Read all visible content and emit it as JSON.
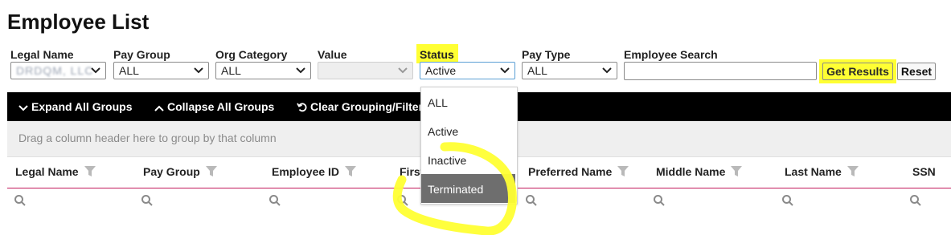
{
  "page": {
    "title": "Employee List"
  },
  "filters": {
    "legal_name": {
      "label": "Legal Name",
      "value": "DRDQM, LLC"
    },
    "pay_group": {
      "label": "Pay Group",
      "value": "ALL"
    },
    "org_category": {
      "label": "Org Category",
      "value": "ALL"
    },
    "value_field": {
      "label": "Value",
      "value": ""
    },
    "status": {
      "label": "Status",
      "value": "Active"
    },
    "pay_type": {
      "label": "Pay Type",
      "value": "ALL"
    },
    "employee_search": {
      "label": "Employee Search",
      "value": ""
    }
  },
  "buttons": {
    "get_results": "Get Results",
    "reset": "Reset"
  },
  "toolbar": {
    "expand": "Expand All Groups",
    "collapse": "Collapse All Groups",
    "clear": "Clear Grouping/Filters"
  },
  "group_hint": "Drag a column header here to group by that column",
  "columns": [
    "Legal Name",
    "Pay Group",
    "Employee ID",
    "First Name",
    "Preferred Name",
    "Middle Name",
    "Last Name",
    "SSN"
  ],
  "status_options": [
    "ALL",
    "Active",
    "Inactive",
    "Terminated"
  ],
  "status_selected": "Terminated",
  "colors": {
    "highlight": "#ffff33",
    "toolbar": "#000000",
    "header_rule": "#c2185b",
    "selected_option": "#6e6e6e"
  }
}
